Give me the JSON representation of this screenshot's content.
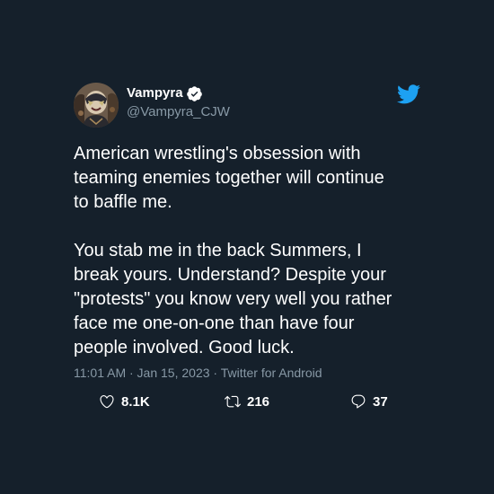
{
  "tweet": {
    "author": {
      "display_name": "Vampyra",
      "handle": "@Vampyra_CJW",
      "verified": true,
      "avatar_icon": "avatar-masked-wrestler"
    },
    "platform_icon": "twitter-bird-icon",
    "body": {
      "paragraph_1": "American wrestling's obsession with teaming enemies together will continue to baffle me.",
      "paragraph_2": "You stab me in the back Summers, I break yours. Understand? Despite your \"protests\" you know very well you rather face me one-on-one than have four people involved. Good luck.",
      "lines_1": [
        "American wrestling's obsession with",
        "teaming enemies together will continue",
        "to baffle me."
      ],
      "lines_2": [
        "You stab me in the back Summers, I",
        "break yours. Understand? Despite your",
        "\"protests\" you know very well you rather",
        "face me one-on-one than have four",
        "people involved. Good luck."
      ]
    },
    "meta": "11:01 AM · Jan 15, 2023 · Twitter for Android",
    "stats": {
      "likes": "8.1K",
      "retweets": "216",
      "replies": "37"
    },
    "colors": {
      "background": "#15202b",
      "text": "#ffffff",
      "secondary_text": "#8899a6",
      "accent": "#1da1f2"
    }
  }
}
